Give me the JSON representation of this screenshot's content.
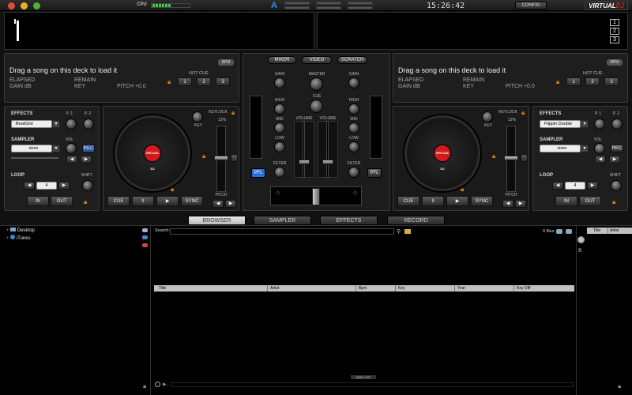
{
  "topbar": {
    "cpu_label": "CPU",
    "clock": "15:26:42",
    "config_label": "CONFIG",
    "logo_part1": "VIRTUAL",
    "logo_part2": "DJ",
    "colors": {
      "mac_red": "#e24b3c",
      "mac_yellow": "#e6b330",
      "mac_green": "#4fb13b",
      "cpu_green": "#3ccf3c"
    }
  },
  "wave_buttons": [
    "1",
    "2",
    "3"
  ],
  "deck_left": {
    "drag_text": "Drag a song on this deck to load it",
    "bpm_label": "BPM",
    "elapsed_label": "ELAPSED",
    "remain_label": "REMAIN",
    "gain_label": "GAIN dB",
    "key_label": "KEY",
    "pitch_text": "PITCH +0.0",
    "hot_cue_label": "HOT CUE",
    "hot_cues": [
      "1",
      "2",
      "3"
    ],
    "effects_label": "EFFECTS",
    "p1_label": "P. 1",
    "p2_label": "P. 2",
    "effect_selected": "BeatGrid",
    "sampler_label": "SAMPLER",
    "sampler_selected": "siren",
    "vol_label": "VOL",
    "rec_label": "REC",
    "loop_label": "LOOP",
    "loop_value": "4",
    "shift_label": "SHIFT",
    "in_label": "IN",
    "out_label": "OUT",
    "keylock_label": "KEYLOCK",
    "keylock_pct": "12%",
    "key_knob_label": "KEY",
    "pitch_label": "PITCH",
    "cue_label": "CUE",
    "pause_icon": "II",
    "play_icon": "▶",
    "sync_label": "SYNC",
    "platter_label": "VIRTUAL DJ"
  },
  "deck_right": {
    "drag_text": "Drag a song on this deck to load it",
    "bpm_label": "BPM",
    "elapsed_label": "ELAPSED",
    "remain_label": "REMAIN",
    "gain_label": "GAIN dB",
    "key_label": "KEY",
    "pitch_text": "PITCH +0.0",
    "hot_cue_label": "HOT CUE",
    "hot_cues": [
      "1",
      "2",
      "3"
    ],
    "effects_label": "EFFECTS",
    "p1_label": "P. 1",
    "p2_label": "P. 2",
    "effect_selected": "Flippin Double",
    "sampler_label": "SAMPLER",
    "sampler_selected": "siren",
    "vol_label": "VOL",
    "rec_label": "REC",
    "loop_label": "LOOP",
    "loop_value": "4",
    "shift_label": "SHIFT",
    "in_label": "IN",
    "out_label": "OUT",
    "keylock_label": "KEYLOCK",
    "keylock_pct": "12%",
    "key_knob_label": "KEY",
    "pitch_label": "PITCH",
    "cue_label": "CUE",
    "pause_icon": "II",
    "play_icon": "▶",
    "sync_label": "SYNC",
    "platter_label": "VIRTUAL DJ"
  },
  "mixer": {
    "tabs": [
      "MIXER",
      "VIDEO",
      "SCRATCH"
    ],
    "gain_label": "GAIN",
    "master_label": "MASTER",
    "cue_label": "CUE",
    "high_label": "HIGH",
    "mid_label": "MID",
    "low_label": "LOW",
    "filter_label": "FILTER",
    "volume_label": "VOLUME",
    "pfl_label": "PFL",
    "pfl_left_color": "#2a6fd6"
  },
  "browser": {
    "tabs": [
      "BROWSER",
      "SAMPLER",
      "EFFECTS",
      "RECORD"
    ],
    "tree": [
      "Desktop",
      "iTunes"
    ],
    "search_label": "Search:",
    "files_count": "0 files",
    "columns": [
      "Title",
      "Artist",
      "Bpm",
      "Key",
      "Year",
      "Key Diff"
    ],
    "side_columns": [
      "Title",
      "Artist"
    ],
    "side_list_label": "SIDE LIST"
  }
}
